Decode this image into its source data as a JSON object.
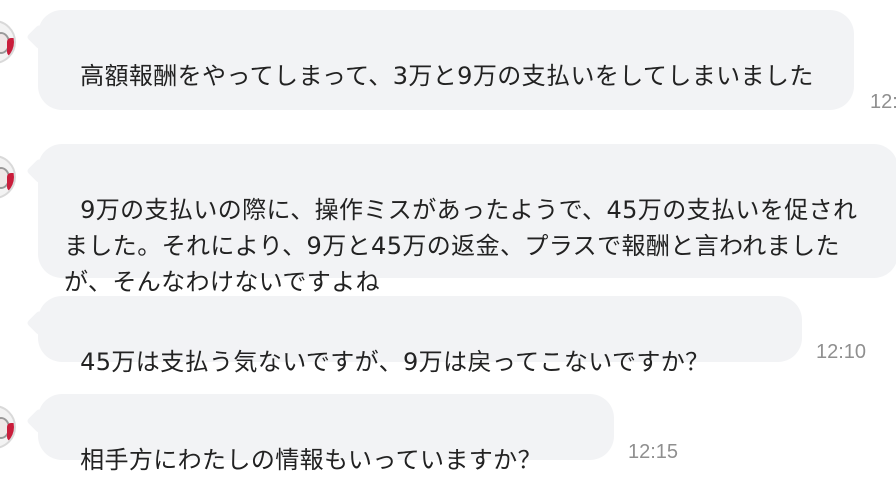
{
  "messages": [
    {
      "text": "高額報酬をやってしまって、3万と9万の支払いをしてしまいました",
      "time": "12:"
    },
    {
      "text": "9万の支払いの際に、操作ミスがあったようで、45万の支払いを促されました。それにより、9万と45万の返金、プラスで報酬と言われましたが、そんなわけないですよね",
      "time": ""
    },
    {
      "text": "45万は支払う気ないですが、9万は戻ってこないですか？",
      "time": "12:10"
    },
    {
      "text": "相手方にわたしの情報もいっていますか？",
      "time": "12:15"
    }
  ]
}
